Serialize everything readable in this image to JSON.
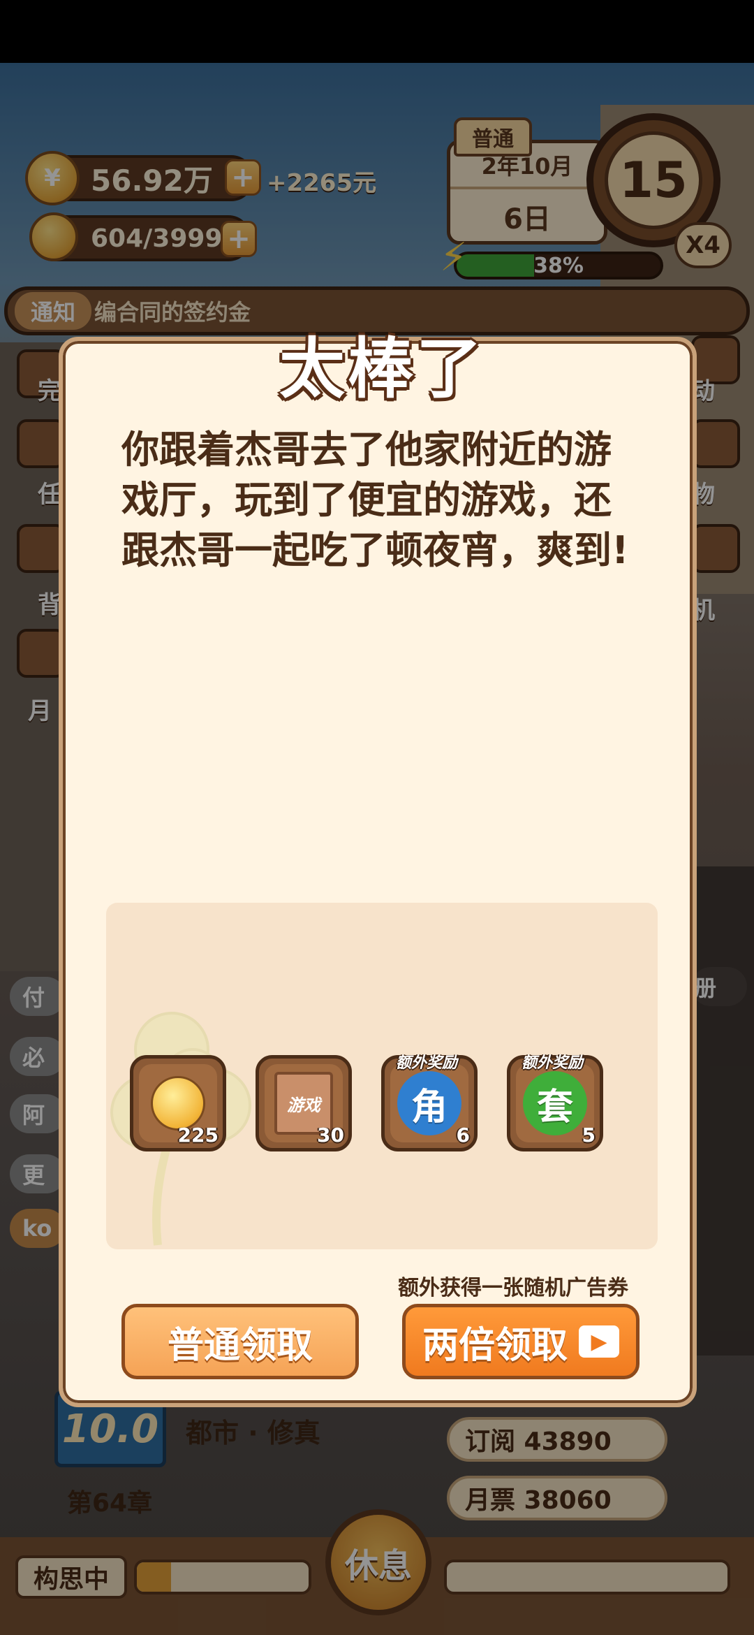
{
  "hud": {
    "coins": "56.92万",
    "coin_bonus": "+2265元",
    "ideas": "604/3999",
    "mode": "普通",
    "date_month": "2年10月",
    "date_day": "6日",
    "round": "15",
    "multiplier": "X4",
    "energy_percent": "38%",
    "energy_fraction": 0.38
  },
  "notice": {
    "tag": "通知",
    "text": "编合同的签约金"
  },
  "side": {
    "left_labels": [
      "完",
      "任",
      "背",
      "月"
    ],
    "right_labels": [
      "动",
      "物",
      "机"
    ],
    "left_chips": [
      "付",
      "必",
      "阿",
      "更",
      "ko"
    ],
    "right_chip": "册"
  },
  "book_info": {
    "score": "10.0",
    "genre": "都市 · 修真",
    "chapter": "第64章",
    "subscribe": "订阅 43890",
    "monthly_ticket": "月票 38060",
    "thinking": "构思中",
    "rest": "休息",
    "progress_fraction": 0.2
  },
  "modal": {
    "title": "太棒了",
    "story": "你跟着杰哥去了他家附近的游戏厅，玩到了便宜的游戏，还跟杰哥一起吃了顿夜宵，爽到!",
    "rewards": [
      {
        "icon": "idea-bulb-icon",
        "count": "225",
        "label": "",
        "extra": ""
      },
      {
        "icon": "game-book-icon",
        "count": "30",
        "label": "游戏",
        "extra": ""
      },
      {
        "icon": "role-badge-icon",
        "count": "6",
        "label": "角",
        "extra": "额外奖励",
        "color": "#2f7fd0"
      },
      {
        "icon": "set-badge-icon",
        "count": "5",
        "label": "套",
        "extra": "额外奖励",
        "color": "#3fae3a"
      }
    ],
    "extra_note": "额外获得一张随机广告券",
    "btn_normal": "普通领取",
    "btn_double": "两倍领取"
  }
}
